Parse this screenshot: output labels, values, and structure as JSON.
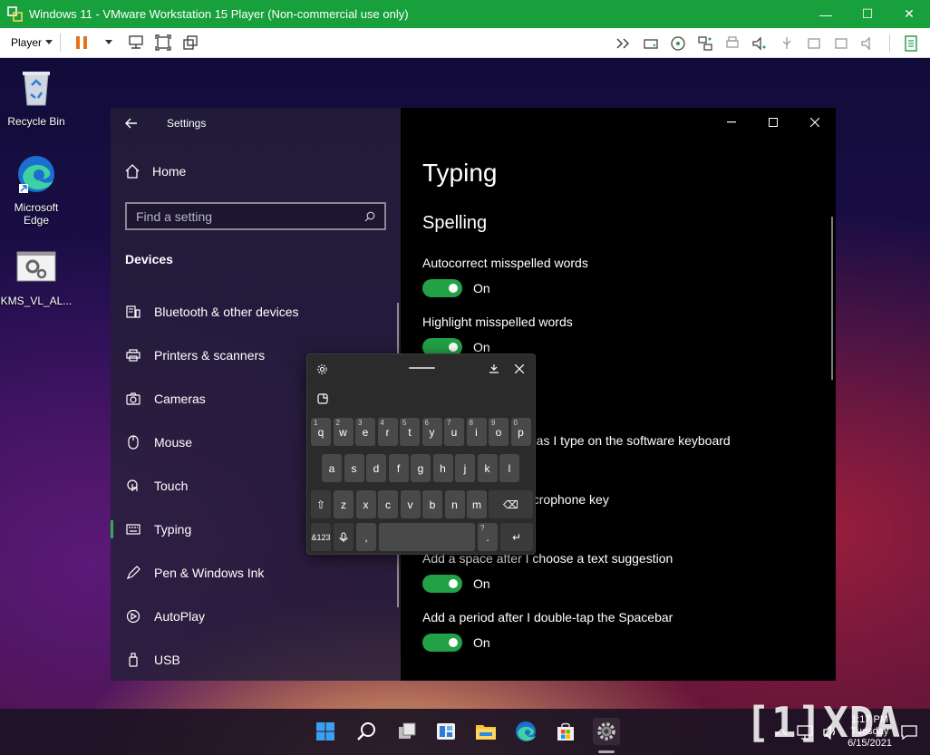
{
  "vm": {
    "title": "Windows 11 - VMware Workstation 15 Player (Non-commercial use only)",
    "player_menu": "Player",
    "window_buttons": {
      "minimize": "—",
      "maximize": "☐",
      "close": "✕"
    }
  },
  "desktop": {
    "icons": [
      {
        "label": "Recycle Bin"
      },
      {
        "label": "Microsoft Edge"
      },
      {
        "label": "KMS_VL_AL..."
      }
    ]
  },
  "settings": {
    "window_title": "Settings",
    "home_label": "Home",
    "search_placeholder": "Find a setting",
    "section": "Devices",
    "nav_items": [
      {
        "label": "Bluetooth & other devices",
        "icon": "bluetooth-devices-icon"
      },
      {
        "label": "Printers & scanners",
        "icon": "printer-icon"
      },
      {
        "label": "Cameras",
        "icon": "camera-icon"
      },
      {
        "label": "Mouse",
        "icon": "mouse-icon"
      },
      {
        "label": "Touch",
        "icon": "touch-icon"
      },
      {
        "label": "Typing",
        "icon": "keyboard-icon",
        "selected": true
      },
      {
        "label": "Pen & Windows Ink",
        "icon": "pen-icon"
      },
      {
        "label": "AutoPlay",
        "icon": "autoplay-icon"
      },
      {
        "label": "USB",
        "icon": "usb-icon"
      }
    ],
    "page_title": "Typing",
    "subheading": "Spelling",
    "options": [
      {
        "label": "Autocorrect misspelled words",
        "state": "On"
      },
      {
        "label": "Highlight misspelled words",
        "state": "On"
      },
      {
        "label": "ns as I type on the software keyboard"
      },
      {
        "label": "microphone key"
      },
      {
        "label": "Add a space after I choose a text suggestion",
        "state": "On"
      },
      {
        "label": "Add a period after I double-tap the Spacebar",
        "state": "On"
      }
    ]
  },
  "keyboard": {
    "row1": [
      {
        "k": "q",
        "h": "1"
      },
      {
        "k": "w",
        "h": "2"
      },
      {
        "k": "e",
        "h": "3"
      },
      {
        "k": "r",
        "h": "4"
      },
      {
        "k": "t",
        "h": "5"
      },
      {
        "k": "y",
        "h": "6"
      },
      {
        "k": "u",
        "h": "7"
      },
      {
        "k": "i",
        "h": "8"
      },
      {
        "k": "o",
        "h": "9"
      },
      {
        "k": "p",
        "h": "0"
      }
    ],
    "row2": [
      "a",
      "s",
      "d",
      "f",
      "g",
      "h",
      "j",
      "k",
      "l"
    ],
    "row3": [
      "z",
      "x",
      "c",
      "v",
      "b",
      "n",
      "m"
    ],
    "symbols_key": "&123",
    "comma_key": ",",
    "period_key": ".",
    "period_hint": "?",
    "enter_key": "↵",
    "backspace_key": "⌫",
    "shift_key": "⇧",
    "mic_key": "🎙"
  },
  "taskbar": {
    "time": "1:17 PM",
    "day": "Tuesday",
    "date": "6/15/2021"
  },
  "watermark": "[1]XDA"
}
